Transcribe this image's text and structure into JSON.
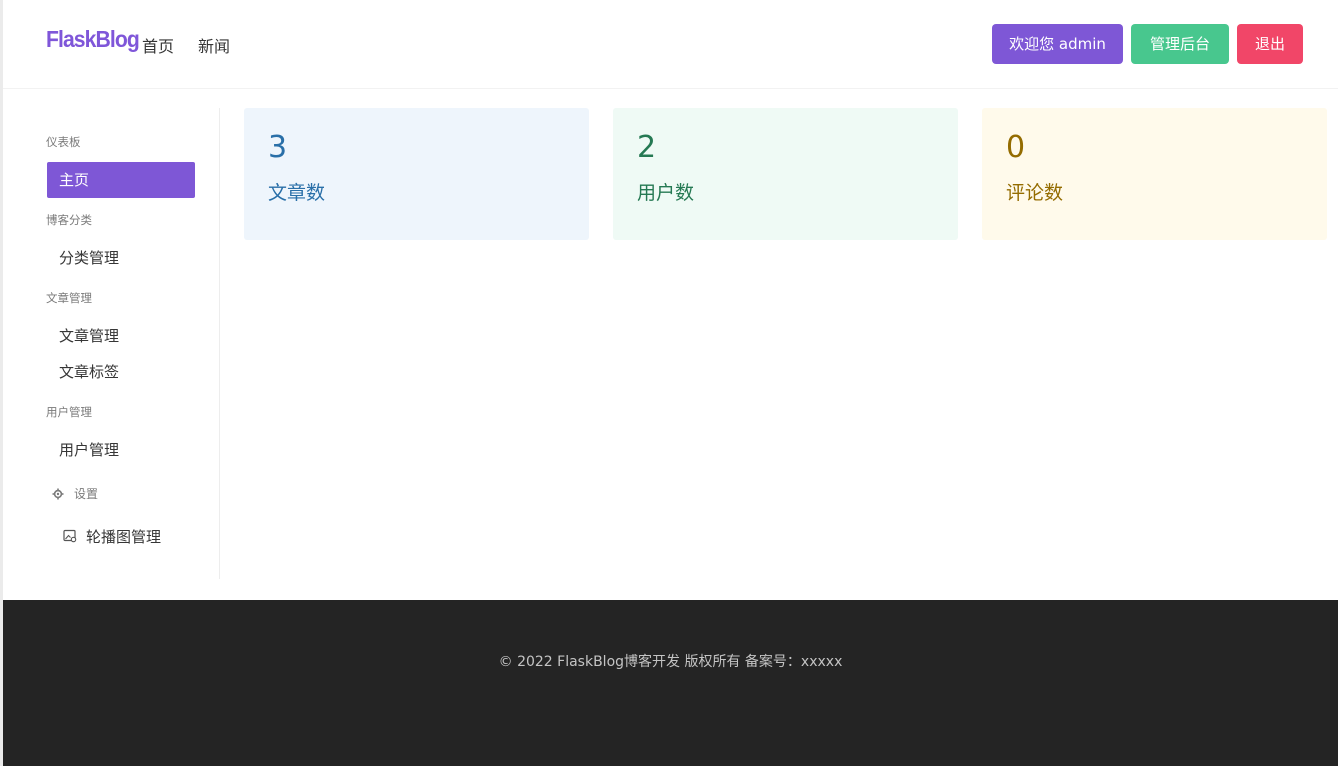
{
  "navbar": {
    "brand": "FlaskBlog",
    "links": [
      "首页",
      "新闻"
    ],
    "welcome_button": "欢迎您 admin",
    "admin_button": "管理后台",
    "logout_button": "退出"
  },
  "sidebar": {
    "sections": [
      {
        "label": "仪表板",
        "items": [
          "主页"
        ]
      },
      {
        "label": "博客分类",
        "items": [
          "分类管理"
        ]
      },
      {
        "label": "文章管理",
        "items": [
          "文章管理",
          "文章标签"
        ]
      },
      {
        "label": "用户管理",
        "items": [
          "用户管理"
        ]
      }
    ],
    "settings_label": "设置",
    "settings_items": [
      "轮播图管理"
    ],
    "active_item": "主页"
  },
  "stats": [
    {
      "value": "3",
      "label": "文章数",
      "color": "#296fa8"
    },
    {
      "value": "2",
      "label": "用户数",
      "color": "#257953"
    },
    {
      "value": "0",
      "label": "评论数",
      "color": "#946c00"
    }
  ],
  "footer": {
    "text": "© 2022 FlaskBlog博客开发 版权所有 备案号：xxxxx"
  },
  "colors": {
    "primary": "#7e57d6",
    "success": "#48c78e",
    "danger": "#f14668",
    "footer_bg": "#242424"
  },
  "icons": {
    "settings": "gear-icon",
    "carousel": "image-icon"
  }
}
